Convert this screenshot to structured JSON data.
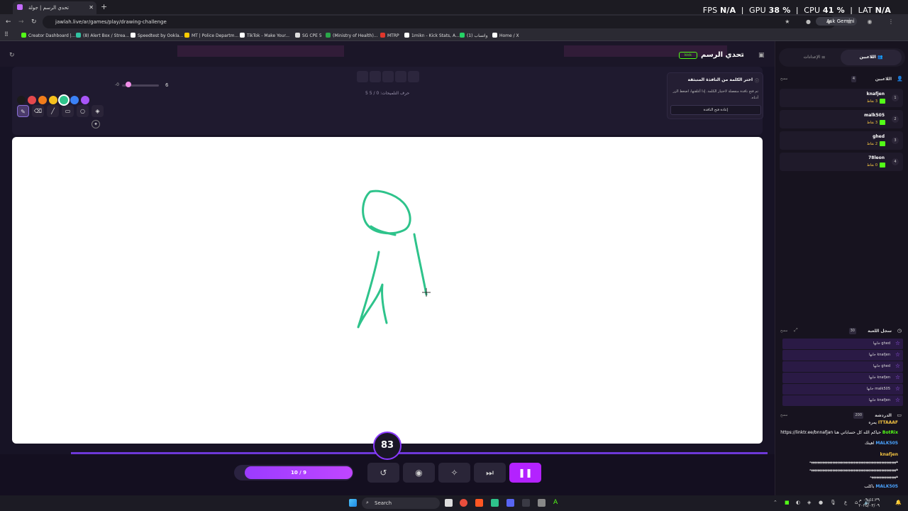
{
  "browser": {
    "tab_title": "تحدي الرسم | جولة",
    "url": "jawlah.live/ar/games/play/drawing-challenge",
    "ask_gemini": "Ask Gemini",
    "perf": {
      "fps_label": "FPS",
      "fps": "N/A",
      "gpu_label": "GPU",
      "gpu": "38 %",
      "cpu_label": "CPU",
      "cpu": "41 %",
      "lat_label": "LAT",
      "lat": "N/A"
    },
    "bookmarks": [
      {
        "label": "Creator Dashboard |...",
        "color": "#53fc18"
      },
      {
        "label": "(8) Alert Box / Strea...",
        "color": "#31c3a2"
      },
      {
        "label": "Speedtest by Ookla...",
        "color": "#ffffff"
      },
      {
        "label": "MT | Police Departm...",
        "color": "#ffcc00"
      },
      {
        "label": "TikTok - Make Your...",
        "color": "#ffffff"
      },
      {
        "label": "SG CPE 5",
        "color": "#dddddd"
      },
      {
        "label": "(Ministry of Health)...",
        "color": "#2aa84a"
      },
      {
        "label": "MTRP",
        "color": "#e0362b"
      },
      {
        "label": "1mikn - Kick Stats, A...",
        "color": "#ffffff"
      },
      {
        "label": "واتساب (1)",
        "color": "#25d366"
      },
      {
        "label": "Home / X",
        "color": "#ffffff"
      }
    ]
  },
  "app": {
    "title": "تحدي الرسم",
    "kick_label": "kick",
    "word_meta": "5 حرف   التلميحات: 0 / 5",
    "brush_min": "-0",
    "brush_size": "6",
    "tools": [
      "pen",
      "eraser",
      "line",
      "rectangle",
      "circle",
      "fill"
    ],
    "palette": [
      "#1b1b1b",
      "#e5484d",
      "#f07c1b",
      "#f5c01d",
      "#2ec38b",
      "#3b82f6",
      "#a855f7"
    ],
    "popup": {
      "title": "اختر الكلمة من النافذة المنبثقة",
      "desc": "تم فتح نافذة منفصلة لاختيار الكلمة. إذا أغلقتها، اضغط الزر أدناه.",
      "button": "إعادة فتح النافذة"
    },
    "timer": "83",
    "round": "10 / 9",
    "controls": [
      "undo",
      "eye",
      "hint",
      "skip",
      "pause"
    ]
  },
  "sidebar": {
    "tab_players": "اللاعبين",
    "tab_settings": "الإعدادات",
    "players_header": "اللاعبين",
    "players_count": "4",
    "clear": "مسح",
    "players": [
      {
        "rank": "1",
        "name": "knafjen",
        "points": "3 نقاط"
      },
      {
        "rank": "2",
        "name": "malk505",
        "points": "3 نقاط"
      },
      {
        "rank": "3",
        "name": "ghed",
        "points": "2 نقاط"
      },
      {
        "rank": "4",
        "name": "78leon",
        "points": "0 نقاط"
      }
    ],
    "log_header": "سجل اللعبة",
    "log_count": "30",
    "log": [
      "ghed جابها",
      "knafjen جابها",
      "ghed جابها",
      "knafjen جابها",
      "malk505 جابها",
      "knafjen جابها"
    ],
    "chat_header": "الدردشة",
    "chat_count": "200",
    "chat": [
      {
        "user": "ITTAAAF",
        "text": "يمره"
      },
      {
        "user": "BotRix",
        "text": "حياكم الله كل حساباتي هنا https://linktr.ee/bnnafjan"
      },
      {
        "user": "MALK505",
        "text": "اهينك"
      },
      {
        "user": "knafjen",
        "text": ""
      },
      {
        "user": "",
        "text": "هههههههههههههههههههههههههههههههههههههههههههههههههههههه"
      },
      {
        "user": "",
        "text": "هههههههههههههههههههههههههههههههههههههههههههههههههههههه"
      },
      {
        "user": "",
        "text": "ههههههههههههههههه"
      },
      {
        "user": "MALK505",
        "text": "باكلب"
      }
    ]
  },
  "taskbar": {
    "search": "Search",
    "time": "٠٩:٤٤:٣٩ م",
    "date": "٢٠٢٥/٠٣/٠٩"
  }
}
